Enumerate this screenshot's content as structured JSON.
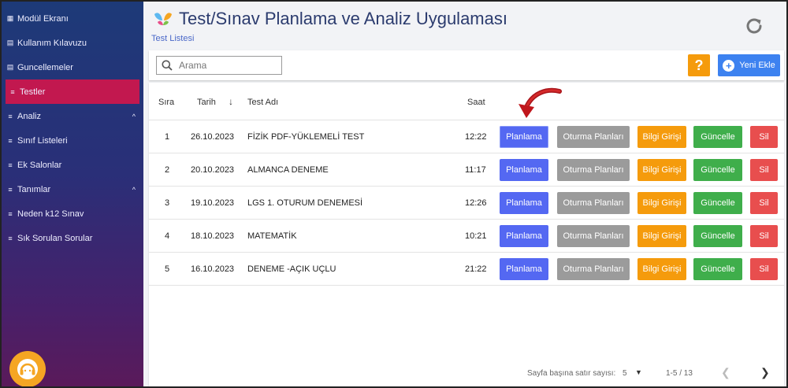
{
  "sidebar": {
    "items": [
      {
        "label": "Modül Ekranı",
        "icon": "grid-icon",
        "active": false
      },
      {
        "label": "Kullanım Kılavuzu",
        "icon": "book-icon",
        "active": false
      },
      {
        "label": "Guncellemeler",
        "icon": "book-icon",
        "active": false
      },
      {
        "label": "Testler",
        "icon": "list-icon",
        "active": true
      },
      {
        "label": "Analiz",
        "icon": "list-icon",
        "active": false,
        "chevron": "^"
      },
      {
        "label": "Sınıf Listeleri",
        "icon": "list-icon",
        "active": false
      },
      {
        "label": "Ek Salonlar",
        "icon": "list-icon",
        "active": false
      },
      {
        "label": "Tanımlar",
        "icon": "list-icon",
        "active": false,
        "chevron": "^"
      },
      {
        "label": "Neden k12 Sınav",
        "icon": "list-icon",
        "active": false
      },
      {
        "label": "Sık Sorulan Sorular",
        "icon": "list-icon",
        "active": false
      }
    ]
  },
  "header": {
    "title": "Test/Sınav Planlama ve Analiz Uygulaması",
    "breadcrumb": "Test Listesi"
  },
  "toolbar": {
    "search_placeholder": "Arama",
    "help_label": "?",
    "add_label": "Yeni Ekle"
  },
  "table": {
    "columns": {
      "sira": "Sıra",
      "tarih": "Tarih",
      "test_adi": "Test Adı",
      "saat": "Saat"
    },
    "actions": {
      "planlama": "Planlama",
      "oturma": "Oturma Planları",
      "bilgi": "Bilgi Girişi",
      "guncelle": "Güncelle",
      "sil": "Sil"
    },
    "rows": [
      {
        "sira": "1",
        "tarih": "26.10.2023",
        "test_adi": "FİZİK PDF-YÜKLEMELİ TEST",
        "saat": "12:22"
      },
      {
        "sira": "2",
        "tarih": "20.10.2023",
        "test_adi": "ALMANCA DENEME",
        "saat": "11:17"
      },
      {
        "sira": "3",
        "tarih": "19.10.2023",
        "test_adi": "LGS 1. OTURUM DENEMESİ",
        "saat": "12:26"
      },
      {
        "sira": "4",
        "tarih": "18.10.2023",
        "test_adi": "MATEMATİK",
        "saat": "10:21"
      },
      {
        "sira": "5",
        "tarih": "16.10.2023",
        "test_adi": "DENEME -AÇIK UÇLU",
        "saat": "21:22"
      }
    ]
  },
  "pagination": {
    "rows_per_page_label": "Sayfa başına satır sayısı:",
    "rows_per_page": "5",
    "range": "1-5 / 13"
  },
  "colors": {
    "active_nav": "#c2184f",
    "primary": "#5468f2",
    "grey": "#9b9b9b",
    "orange": "#f59b0c",
    "green": "#3fae4b",
    "red": "#e84e4e",
    "add": "#3d82f0",
    "arrow": "#c0161c"
  }
}
